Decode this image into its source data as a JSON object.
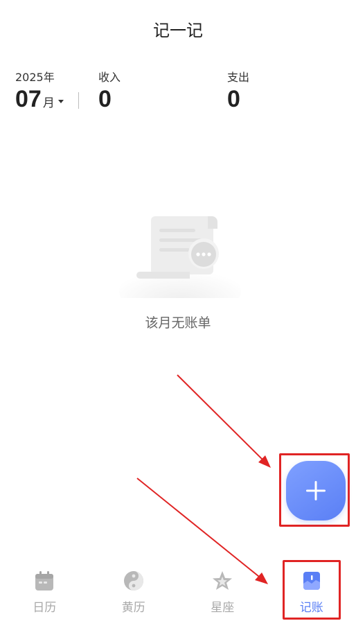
{
  "header": {
    "title": "记一记"
  },
  "summary": {
    "year": "2025年",
    "month": "07",
    "month_unit": "月",
    "income_label": "收入",
    "income_value": "0",
    "expense_label": "支出",
    "expense_value": "0"
  },
  "empty_state": {
    "message": "该月无账单"
  },
  "fab": {
    "icon": "plus-icon"
  },
  "colors": {
    "accent": "#5a7ff5",
    "highlight": "#e02424",
    "tab_inactive": "#a8a8a8"
  },
  "tabs": [
    {
      "label": "日历",
      "icon": "calendar-icon",
      "active": false
    },
    {
      "label": "黄历",
      "icon": "yin-yang-icon",
      "active": false
    },
    {
      "label": "星座",
      "icon": "star-icon",
      "active": false
    },
    {
      "label": "记账",
      "icon": "ledger-icon",
      "active": true
    }
  ]
}
